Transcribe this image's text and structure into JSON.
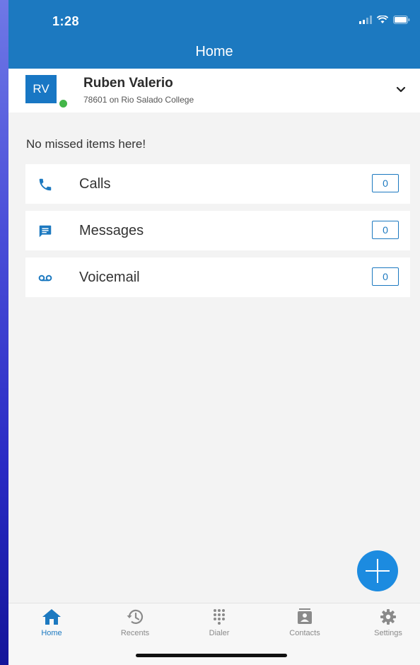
{
  "status_bar": {
    "time": "1:28"
  },
  "header": {
    "title": "Home"
  },
  "account": {
    "initials": "RV",
    "name": "Ruben Valerio",
    "subtitle": "78601 on Rio Salado College",
    "presence": "available"
  },
  "missed": {
    "label": "No missed items here!",
    "items": [
      {
        "label": "Calls",
        "count": "0",
        "icon": "phone-icon"
      },
      {
        "label": "Messages",
        "count": "0",
        "icon": "message-icon"
      },
      {
        "label": "Voicemail",
        "count": "0",
        "icon": "voicemail-icon"
      }
    ]
  },
  "fab": {
    "icon": "plus-icon"
  },
  "tabs": [
    {
      "label": "Home",
      "icon": "home-icon",
      "active": true
    },
    {
      "label": "Recents",
      "icon": "history-icon",
      "active": false
    },
    {
      "label": "Dialer",
      "icon": "dialpad-icon",
      "active": false
    },
    {
      "label": "Contacts",
      "icon": "contacts-icon",
      "active": false
    },
    {
      "label": "Settings",
      "icon": "gear-icon",
      "active": false
    }
  ],
  "colors": {
    "brand": "#1c79c0",
    "accent": "#1c8be0",
    "presence": "#43b649",
    "background": "#f3f3f3"
  }
}
